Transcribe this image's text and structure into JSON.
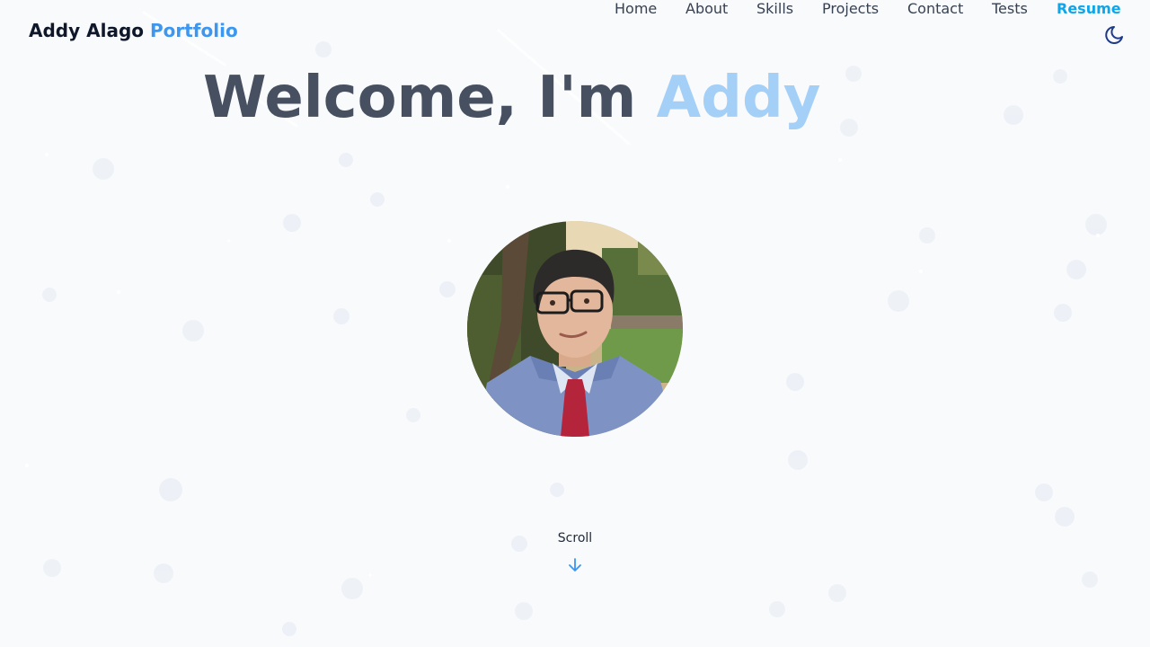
{
  "brand": {
    "name": "Addy Alago",
    "suffix": "Portfolio"
  },
  "nav": {
    "items": [
      {
        "label": "Home"
      },
      {
        "label": "About"
      },
      {
        "label": "Skills"
      },
      {
        "label": "Projects"
      },
      {
        "label": "Contact"
      },
      {
        "label": "Tests"
      },
      {
        "label": "Resume"
      }
    ],
    "theme_toggle_icon": "moon-icon"
  },
  "hero": {
    "greeting": "Welcome, I'm",
    "name": "Addy",
    "avatar_icon": "profile-photo"
  },
  "scroll": {
    "label": "Scroll",
    "icon": "arrow-down-icon"
  },
  "colors": {
    "background": "#f8fafc",
    "accent": "#3b97f0",
    "resume": "#0ea5e9",
    "name_highlight": "#a4cff7",
    "title_text": "#475061"
  }
}
